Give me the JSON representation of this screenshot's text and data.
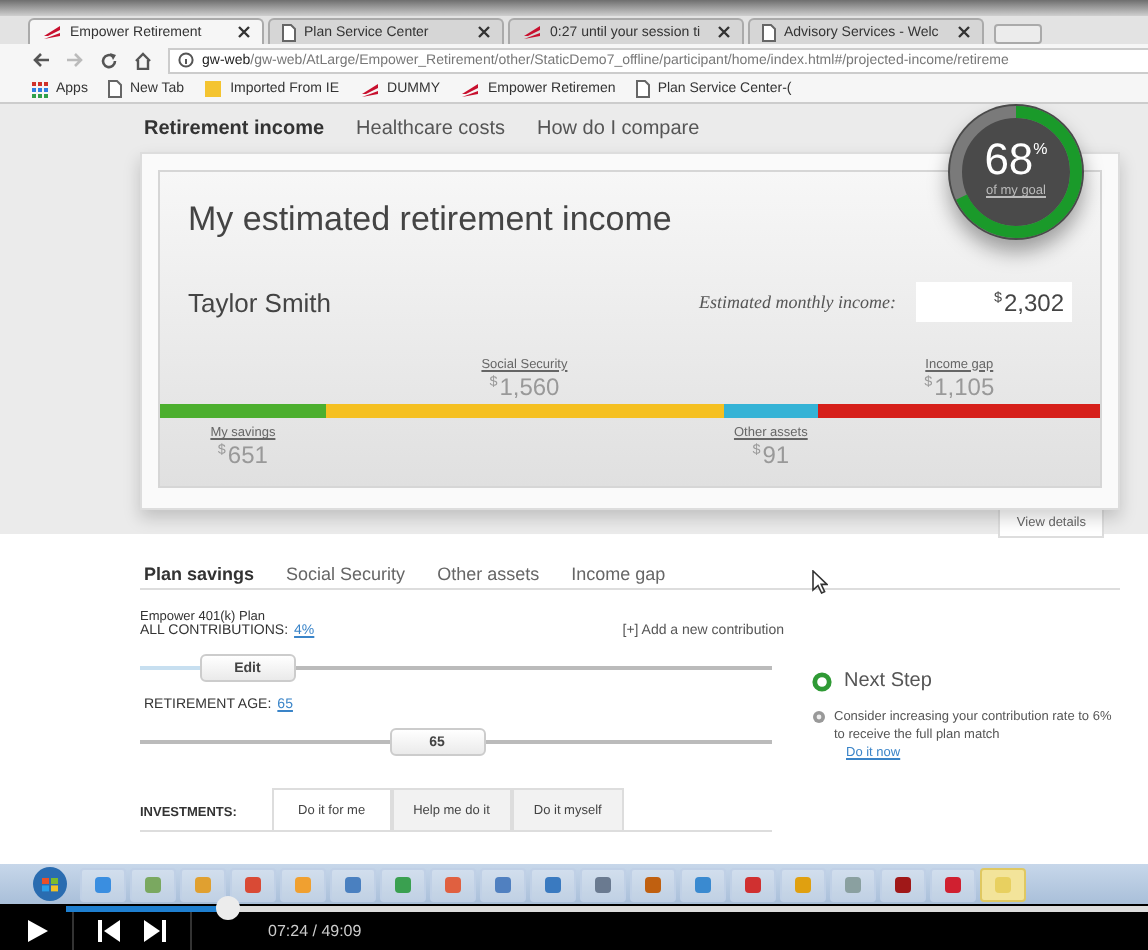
{
  "browser": {
    "tabs": [
      {
        "title": "Empower Retirement",
        "kind": "logo",
        "selected": true
      },
      {
        "title": "Plan Service Center",
        "kind": "page",
        "selected": false
      },
      {
        "title": "0:27 until your session ti",
        "kind": "logo",
        "selected": false
      },
      {
        "title": "Advisory Services - Welc",
        "kind": "page",
        "selected": false
      }
    ],
    "address": {
      "host": "gw-web",
      "path": "/gw-web/AtLarge/Empower_Retirement/other/StaticDemo7_offline/participant/home/index.html#/projected-income/retireme"
    },
    "bookmarks": [
      {
        "label": "Apps",
        "kind": "apps"
      },
      {
        "label": "New Tab",
        "kind": "page"
      },
      {
        "label": "Imported From IE",
        "kind": "folder"
      },
      {
        "label": "DUMMY",
        "kind": "logo"
      },
      {
        "label": "Empower Retiremen",
        "kind": "logo"
      },
      {
        "label": "Plan Service Center-(",
        "kind": "page"
      }
    ]
  },
  "page": {
    "nav": [
      {
        "label": "Retirement income",
        "selected": true
      },
      {
        "label": "Healthcare costs",
        "selected": false
      },
      {
        "label": "How do I compare",
        "selected": false
      }
    ],
    "card": {
      "title": "My estimated retirement income",
      "name": "Taylor Smith",
      "goal": {
        "value": "68",
        "unit": "%",
        "caption": "of my goal",
        "level": 0.68
      },
      "monthly": {
        "label": "Estimated monthly income:",
        "currency": "$",
        "amount": "2,302"
      },
      "segments": [
        {
          "label": "My savings",
          "currency": "$",
          "amount": "651",
          "color": "#4caf2e"
        },
        {
          "label": "Social Security",
          "currency": "$",
          "amount": "1,560",
          "color": "#f5c021"
        },
        {
          "label": "Other assets",
          "currency": "$",
          "amount": "91",
          "color": "#35b3d6"
        },
        {
          "label": "Income gap",
          "currency": "$",
          "amount": "1,105",
          "color": "#d61f1a"
        }
      ],
      "details_tab": "View details"
    },
    "plan_tabs": [
      {
        "label": "Plan savings",
        "selected": true
      },
      {
        "label": "Social Security",
        "selected": false
      },
      {
        "label": "Other assets",
        "selected": false
      },
      {
        "label": "Income gap",
        "selected": false
      }
    ],
    "plan_name": "Empower 401(k) Plan",
    "contributions": {
      "label": "ALL CONTRIBUTIONS:",
      "value": "4%",
      "add": "[+] Add a new contribution",
      "slider": {
        "thumb": "Edit",
        "level": 0.17
      }
    },
    "retirement_age": {
      "label": "RETIREMENT AGE:",
      "value": "65",
      "slider": {
        "thumb": "65",
        "level": 0.47
      }
    },
    "next_step": {
      "title": "Next Step",
      "text": "Consider increasing your contribution rate to 6% to receive the full plan match",
      "link": "Do it now"
    },
    "investments": {
      "label": "INVESTMENTS:",
      "tabs": [
        {
          "label": "Do it for me",
          "selected": true
        },
        {
          "label": "Help me do it",
          "selected": false
        },
        {
          "label": "Do it myself",
          "selected": false
        }
      ]
    }
  },
  "player": {
    "time": "07:24 / 49:09",
    "level": 0.15
  }
}
